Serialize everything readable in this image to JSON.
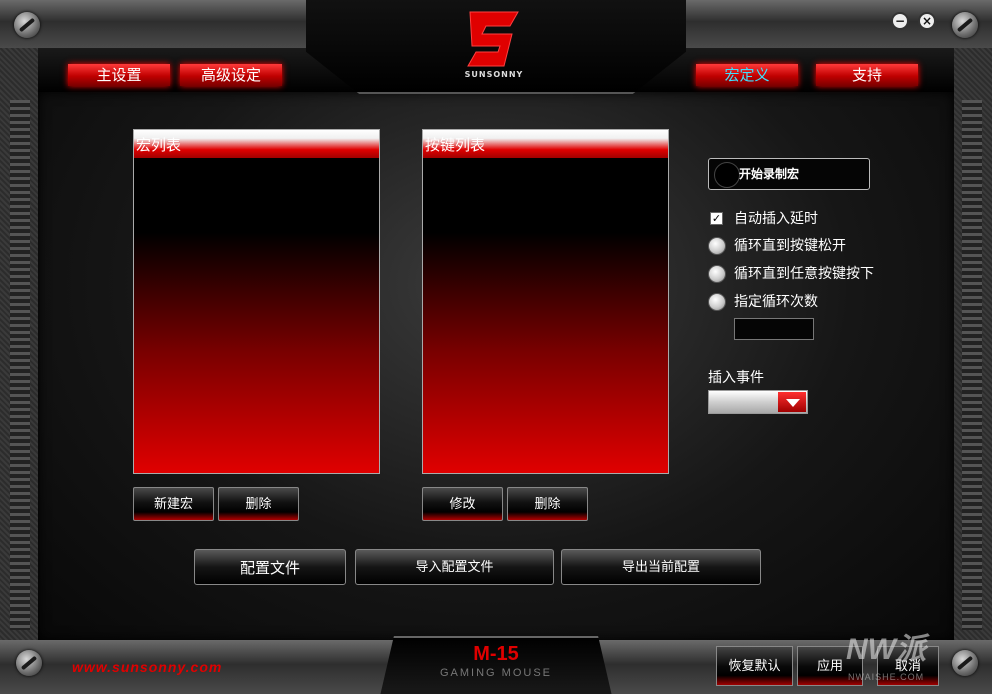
{
  "brand": {
    "logo_text": "SUNSONNY",
    "url": "www.sunsonny.com",
    "model": "M-15",
    "model_sub": "GAMING MOUSE"
  },
  "nav": {
    "main_settings": "主设置",
    "advanced_settings": "高级设定",
    "macro": "宏定义",
    "support": "支持"
  },
  "window": {
    "minimize": "−",
    "close": "×"
  },
  "macro_list": {
    "header": "宏列表",
    "new_label": "新建宏",
    "delete_label": "删除"
  },
  "key_list": {
    "header": "按键列表",
    "modify_label": "修改",
    "delete_label": "删除"
  },
  "record": {
    "label": "开始录制宏"
  },
  "options": {
    "auto_delay": {
      "label": "自动插入延时",
      "checked": true
    },
    "loop_until_release": "循环直到按键松开",
    "loop_until_any": "循环直到任意按键按下",
    "loop_count": "指定循环次数"
  },
  "loop_count_value": "",
  "insert_event": {
    "label": "插入事件",
    "selected": ""
  },
  "config": {
    "profile": "配置文件",
    "import": "导入配置文件",
    "export": "导出当前配置"
  },
  "footer": {
    "restore": "恢复默认",
    "apply": "应用",
    "cancel": "取消"
  },
  "watermark": {
    "text": "NW派",
    "sub": "NWAISHE.COM"
  },
  "colors": {
    "accent_red": "#e00000",
    "active_nav_text": "#3ee0ff",
    "panel_bg": "#000000"
  }
}
